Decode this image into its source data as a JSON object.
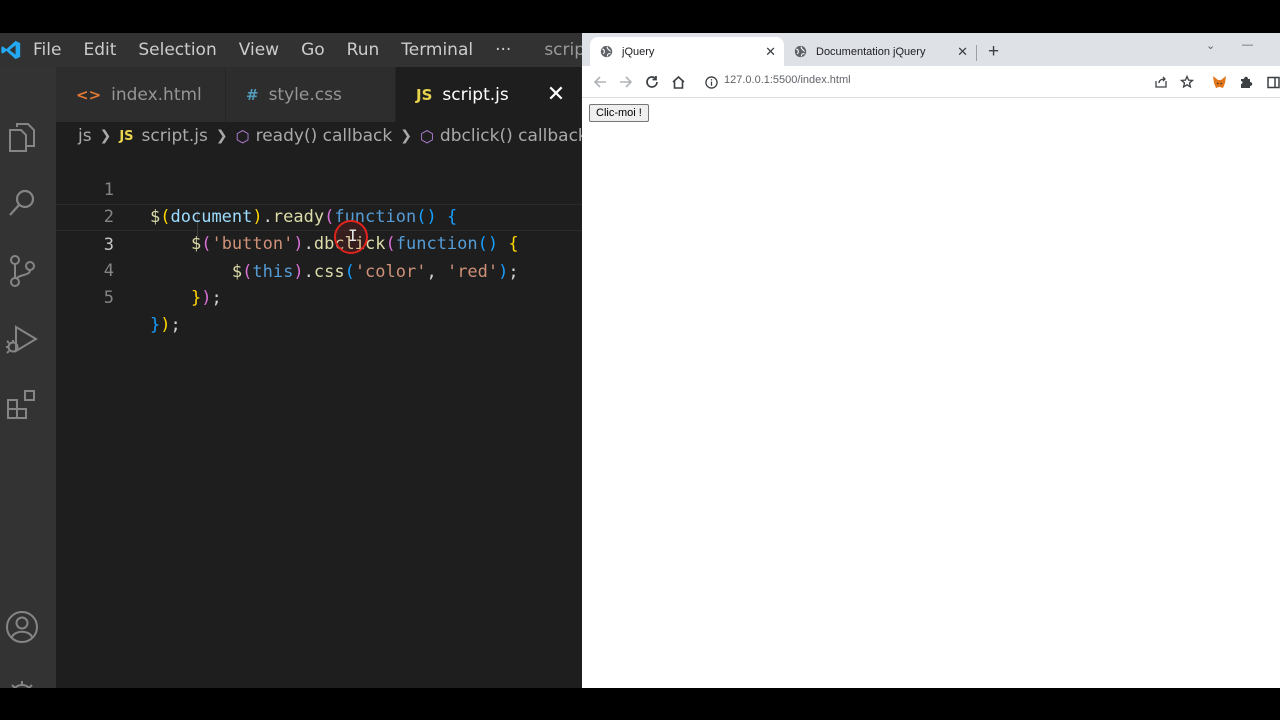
{
  "vscode": {
    "menu": [
      "File",
      "Edit",
      "Selection",
      "View",
      "Go",
      "Run",
      "Terminal",
      "···"
    ],
    "window_title": "scrip",
    "tabs": [
      {
        "label": "index.html",
        "icon": "html-icon",
        "color": "#e37933"
      },
      {
        "label": "style.css",
        "icon": "hash-icon",
        "color": "#519aba"
      },
      {
        "label": "script.js",
        "icon": "js-icon",
        "color": "#e8d44d",
        "active": true
      }
    ],
    "breadcrumb": [
      "js",
      "script.js",
      "ready() callback",
      "dbclick() callback"
    ],
    "line_numbers": [
      "1",
      "2",
      "3",
      "4",
      "5"
    ],
    "current_line": 3
  },
  "browser": {
    "tabs": [
      {
        "title": "jQuery",
        "active": true
      },
      {
        "title": "Documentation jQuery",
        "active": false
      }
    ],
    "url": "127.0.0.1:5500/index.html",
    "page_button": "Clic-moi !"
  },
  "colors": {
    "editor_bg": "#1e1e1e",
    "activity_bar": "#333333",
    "accent_vscode": "#0078d4",
    "cursor_highlight": "#e0231c"
  }
}
